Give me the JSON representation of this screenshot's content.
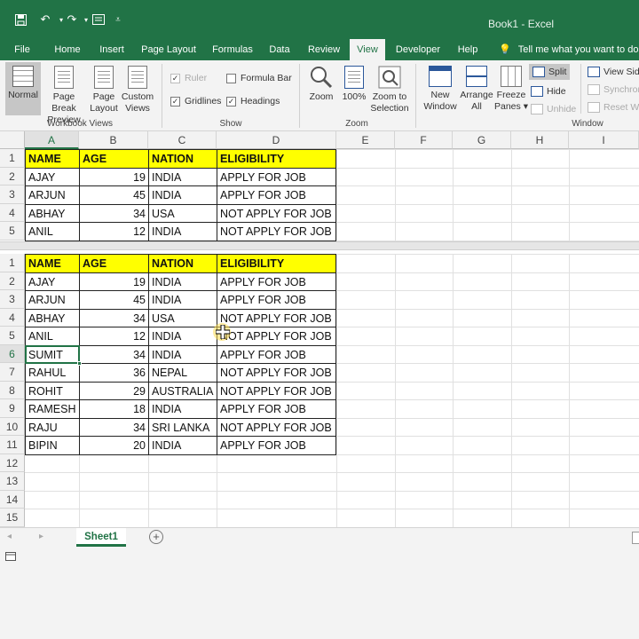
{
  "window": {
    "title": "Book1 - Excel"
  },
  "tabs": [
    "File",
    "Home",
    "Insert",
    "Page Layout",
    "Formulas",
    "Data",
    "Review",
    "View",
    "Developer",
    "Help"
  ],
  "active_tab": "View",
  "tell_me": "Tell me what you want to do",
  "ribbon": {
    "normal": "Normal",
    "page_break": "Page Break Preview",
    "page_layout": "Page Layout",
    "custom_views": "Custom Views",
    "workbook_views_label": "Workbook Views",
    "ruler": "Ruler",
    "formula_bar": "Formula Bar",
    "gridlines": "Gridlines",
    "headings": "Headings",
    "show_label": "Show",
    "zoom": "Zoom",
    "zoom100": "100%",
    "zoom_selection": "Zoom to Selection",
    "zoom_label": "Zoom",
    "new_window": "New Window",
    "arrange_all": "Arrange All",
    "freeze_panes": "Freeze Panes",
    "split": "Split",
    "hide": "Hide",
    "unhide": "Unhide",
    "view_side": "View Side",
    "synchronous": "Synchron",
    "reset_window": "Reset Win",
    "window_label": "Window"
  },
  "columns": [
    "A",
    "B",
    "C",
    "D",
    "E",
    "F",
    "G",
    "H",
    "I"
  ],
  "headers": [
    "NAME",
    "AGE",
    "NATION",
    "ELIGIBILITY"
  ],
  "rows": [
    [
      "AJAY",
      "19",
      "INDIA",
      "APPLY FOR JOB"
    ],
    [
      "ARJUN",
      "45",
      "INDIA",
      "APPLY FOR JOB"
    ],
    [
      "ABHAY",
      "34",
      "USA",
      "NOT APPLY FOR JOB"
    ],
    [
      "ANIL",
      "12",
      "INDIA",
      "NOT APPLY FOR JOB"
    ],
    [
      "SUMIT",
      "34",
      "INDIA",
      "APPLY FOR JOB"
    ],
    [
      "RAHUL",
      "36",
      "NEPAL",
      "NOT APPLY FOR JOB"
    ],
    [
      "ROHIT",
      "29",
      "AUSTRALIA",
      "NOT APPLY FOR JOB"
    ],
    [
      "RAMESH",
      "18",
      "INDIA",
      "APPLY FOR JOB"
    ],
    [
      "RAJU",
      "34",
      "SRI LANKA",
      "NOT APPLY FOR JOB"
    ],
    [
      "BIPIN",
      "20",
      "INDIA",
      "APPLY FOR JOB"
    ]
  ],
  "top_pane_rows": [
    "1",
    "2",
    "3",
    "4",
    "5"
  ],
  "bottom_pane_rows": [
    "1",
    "2",
    "3",
    "4",
    "5",
    "6",
    "7",
    "8",
    "9",
    "10",
    "11",
    "12",
    "13",
    "14",
    "15"
  ],
  "sheet_tab": "Sheet1",
  "active_cell": "A6",
  "colors": {
    "accent": "#217346",
    "header_fill": "#ffff00"
  }
}
